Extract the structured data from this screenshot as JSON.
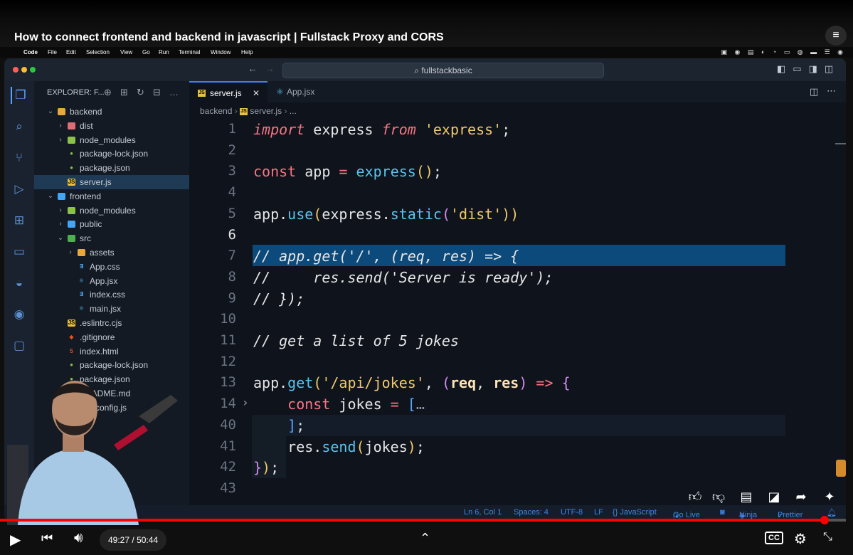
{
  "video": {
    "title": "How to connect frontend and backend in javascript | Fullstack Proxy and CORS",
    "current_time": "49:27",
    "separator": "/",
    "duration": "50:44",
    "progress": 0.975
  },
  "mac_menu": [
    "Code",
    "File",
    "Edit",
    "Selection",
    "View",
    "Go",
    "Run",
    "Terminal",
    "Window",
    "Help"
  ],
  "vscode": {
    "command_center": "fullstackbasic",
    "explorer_title": "EXPLORER: F...",
    "tree": [
      {
        "label": "backend",
        "depth": 0,
        "type": "folder-open",
        "icon": "folder-icon"
      },
      {
        "label": "dist",
        "depth": 1,
        "type": "folder",
        "icon": "folder-icon"
      },
      {
        "label": "node_modules",
        "depth": 1,
        "type": "folder",
        "icon": "folder-icon"
      },
      {
        "label": "package-lock.json",
        "depth": 1,
        "type": "file",
        "icon": "npm-icon"
      },
      {
        "label": "package.json",
        "depth": 1,
        "type": "file",
        "icon": "npm-icon"
      },
      {
        "label": "server.js",
        "depth": 1,
        "type": "file",
        "icon": "js-icon",
        "selected": true
      },
      {
        "label": "frontend",
        "depth": 0,
        "type": "folder-open",
        "icon": "folder-icon"
      },
      {
        "label": "node_modules",
        "depth": 1,
        "type": "folder",
        "icon": "folder-icon"
      },
      {
        "label": "public",
        "depth": 1,
        "type": "folder",
        "icon": "folder-icon"
      },
      {
        "label": "src",
        "depth": 1,
        "type": "folder-open",
        "icon": "folder-icon"
      },
      {
        "label": "assets",
        "depth": 2,
        "type": "folder",
        "icon": "folder-icon"
      },
      {
        "label": "App.css",
        "depth": 2,
        "type": "file",
        "icon": "css-icon"
      },
      {
        "label": "App.jsx",
        "depth": 2,
        "type": "file",
        "icon": "react-icon"
      },
      {
        "label": "index.css",
        "depth": 2,
        "type": "file",
        "icon": "css-icon"
      },
      {
        "label": "main.jsx",
        "depth": 2,
        "type": "file",
        "icon": "react-icon"
      },
      {
        "label": ".eslintrc.cjs",
        "depth": 1,
        "type": "file",
        "icon": "js-icon"
      },
      {
        "label": ".gitignore",
        "depth": 1,
        "type": "file",
        "icon": "git-icon"
      },
      {
        "label": "index.html",
        "depth": 1,
        "type": "file",
        "icon": "html-icon"
      },
      {
        "label": "package-lock.json",
        "depth": 1,
        "type": "file",
        "icon": "npm-icon"
      },
      {
        "label": "package.json",
        "depth": 1,
        "type": "file",
        "icon": "npm-icon"
      },
      {
        "label": "README.md",
        "depth": 1,
        "type": "file",
        "icon": "info-icon"
      },
      {
        "label": "vite.config.js",
        "depth": 1,
        "type": "file",
        "icon": "js-icon"
      }
    ],
    "tabs": [
      {
        "label": "server.js",
        "active": true
      },
      {
        "label": "App.jsx",
        "active": false
      }
    ],
    "breadcrumb": [
      "backend",
      "server.js",
      "..."
    ],
    "code": [
      {
        "n": "1",
        "tokens": [
          [
            "import",
            "kw-i"
          ],
          [
            " express ",
            "plain"
          ],
          [
            "from",
            "kw-i"
          ],
          [
            " ",
            "plain"
          ],
          [
            "'express'",
            "str"
          ],
          [
            ";",
            "plain"
          ]
        ]
      },
      {
        "n": "2",
        "tokens": []
      },
      {
        "n": "3",
        "tokens": [
          [
            "const",
            "kw"
          ],
          [
            " app ",
            "var"
          ],
          [
            "=",
            "op"
          ],
          [
            " ",
            "plain"
          ],
          [
            "express",
            "fn"
          ],
          [
            "()",
            "paren"
          ],
          [
            ";",
            "plain"
          ]
        ]
      },
      {
        "n": "4",
        "tokens": []
      },
      {
        "n": "5",
        "tokens": [
          [
            "app",
            "var"
          ],
          [
            ".",
            "plain"
          ],
          [
            "use",
            "fn"
          ],
          [
            "(",
            "paren"
          ],
          [
            "express",
            "var"
          ],
          [
            ".",
            "plain"
          ],
          [
            "static",
            "fn"
          ],
          [
            "(",
            "paren2"
          ],
          [
            "'dist'",
            "str"
          ],
          [
            "))",
            "paren"
          ]
        ]
      },
      {
        "n": "6",
        "tokens": [],
        "current": true
      },
      {
        "n": "7",
        "tokens": [
          [
            "// app.get('/', (req, res) => {",
            "cmt"
          ]
        ]
      },
      {
        "n": "8",
        "tokens": [
          [
            "//     res.send('Server is ready');",
            "cmt"
          ]
        ]
      },
      {
        "n": "9",
        "tokens": [
          [
            "// });",
            "cmt"
          ]
        ]
      },
      {
        "n": "10",
        "tokens": []
      },
      {
        "n": "11",
        "tokens": [
          [
            "// get a list of 5 jokes",
            "cmt"
          ]
        ]
      },
      {
        "n": "12",
        "tokens": []
      },
      {
        "n": "13",
        "tokens": [
          [
            "app",
            "var"
          ],
          [
            ".",
            "plain"
          ],
          [
            "get",
            "fn"
          ],
          [
            "(",
            "paren"
          ],
          [
            "'/api/jokes'",
            "str"
          ],
          [
            ", ",
            "plain"
          ],
          [
            "(",
            "paren2"
          ],
          [
            "req",
            "param"
          ],
          [
            ", ",
            "plain"
          ],
          [
            "res",
            "param"
          ],
          [
            ")",
            "paren2"
          ],
          [
            " ",
            "plain"
          ],
          [
            "=>",
            "kw"
          ],
          [
            " ",
            "plain"
          ],
          [
            "{",
            "paren2"
          ]
        ]
      },
      {
        "n": "14",
        "tokens": [
          [
            "    ",
            "plain"
          ],
          [
            "const",
            "kw"
          ],
          [
            " jokes ",
            "var"
          ],
          [
            "=",
            "op"
          ],
          [
            " ",
            "plain"
          ],
          [
            "[",
            "br"
          ],
          [
            "…",
            "dim"
          ]
        ],
        "folded": true
      },
      {
        "n": "40",
        "tokens": [
          [
            "    ",
            "plain"
          ],
          [
            "]",
            "br"
          ],
          [
            ";",
            "plain"
          ]
        ]
      },
      {
        "n": "41",
        "tokens": [
          [
            "    ",
            "plain"
          ],
          [
            "res",
            "var"
          ],
          [
            ".",
            "plain"
          ],
          [
            "send",
            "fn"
          ],
          [
            "(",
            "paren"
          ],
          [
            "jokes",
            "var"
          ],
          [
            ")",
            "paren"
          ],
          [
            ";",
            "plain"
          ]
        ]
      },
      {
        "n": "42",
        "tokens": [
          [
            "}",
            "paren2"
          ],
          [
            ")",
            "paren"
          ],
          [
            ";",
            "plain"
          ]
        ]
      },
      {
        "n": "43",
        "tokens": []
      }
    ],
    "status": {
      "position": "Ln 6, Col 1",
      "spaces": "Spaces: 4",
      "encoding": "UTF-8",
      "eol": "LF",
      "language": "{} JavaScript",
      "golive": "Go Live",
      "ninja": "Ninja",
      "prettier": "Prettier"
    }
  },
  "colors": {
    "kw": "#f97583",
    "kw-i": "#f97583",
    "str": "#f2c96b",
    "fn": "#58c4f0",
    "var": "#e6e6e6",
    "op": "#f97583",
    "paren": "#f2c96b",
    "paren2": "#d28cf2",
    "param": "#ffe3b3",
    "cmt": "#e6e6e6",
    "br": "#58a6ff",
    "dim": "#8b95a1",
    "plain": "#e6e6e6"
  }
}
